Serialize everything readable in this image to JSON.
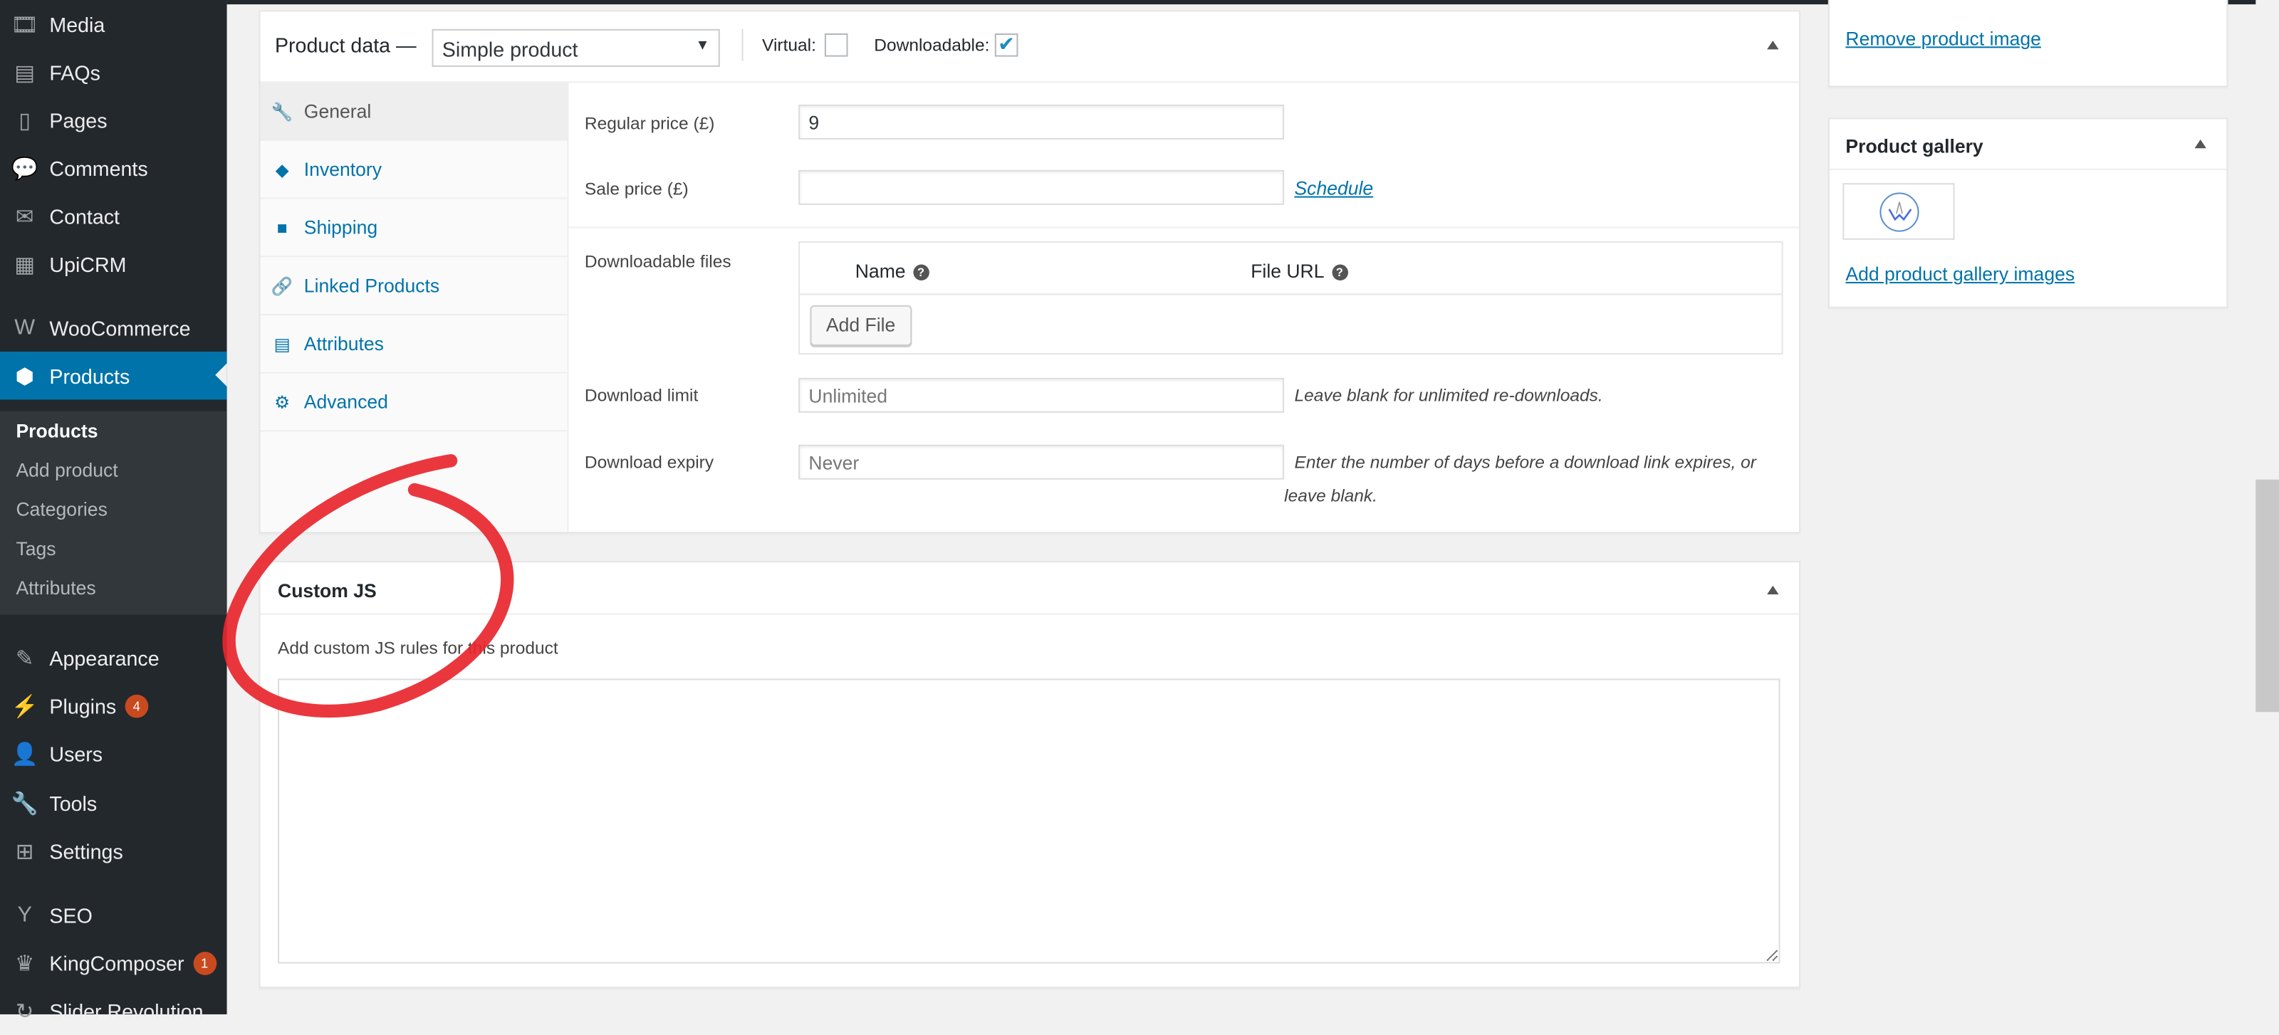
{
  "sidebar": {
    "items": [
      {
        "label": "Media",
        "icon": "media-icon"
      },
      {
        "label": "FAQs",
        "icon": "faq-icon"
      },
      {
        "label": "Pages",
        "icon": "pages-icon"
      },
      {
        "label": "Comments",
        "icon": "comments-icon"
      },
      {
        "label": "Contact",
        "icon": "mail-icon"
      },
      {
        "label": "UpiCRM",
        "icon": "upicrm-icon"
      },
      {
        "label": "WooCommerce",
        "icon": "woo-icon"
      },
      {
        "label": "Products",
        "icon": "box-icon"
      },
      {
        "label": "Appearance",
        "icon": "brush-icon"
      },
      {
        "label": "Plugins",
        "icon": "plugin-icon",
        "badge": "4"
      },
      {
        "label": "Users",
        "icon": "users-icon"
      },
      {
        "label": "Tools",
        "icon": "wrench-icon"
      },
      {
        "label": "Settings",
        "icon": "settings-icon"
      },
      {
        "label": "SEO",
        "icon": "yoast-icon"
      },
      {
        "label": "KingComposer",
        "icon": "crown-icon",
        "badge": "1"
      },
      {
        "label": "Slider Revolution",
        "icon": "refresh-icon"
      }
    ],
    "submenu": [
      "Products",
      "Add product",
      "Categories",
      "Tags",
      "Attributes"
    ]
  },
  "product_data": {
    "title": "Product data —",
    "type": "Simple product",
    "virtual_label": "Virtual:",
    "virtual": false,
    "downloadable_label": "Downloadable:",
    "downloadable": true,
    "tabs": [
      "General",
      "Inventory",
      "Shipping",
      "Linked Products",
      "Attributes",
      "Advanced"
    ],
    "regular_price_label": "Regular price (£)",
    "regular_price": "9",
    "sale_price_label": "Sale price (£)",
    "sale_price": "",
    "schedule": "Schedule",
    "downloadable_files_label": "Downloadable files",
    "col_name": "Name",
    "col_url": "File URL",
    "add_file": "Add File",
    "download_limit_label": "Download limit",
    "download_limit_placeholder": "Unlimited",
    "download_limit_hint": "Leave blank for unlimited re-downloads.",
    "download_expiry_label": "Download expiry",
    "download_expiry_placeholder": "Never",
    "download_expiry_hint1": "Enter the number of days before a download link expires, or",
    "download_expiry_hint2": "leave blank."
  },
  "custom_js": {
    "title": "Custom JS",
    "desc": "Add custom JS rules for this product",
    "value": ""
  },
  "product_image": {
    "remove": "Remove product image"
  },
  "gallery": {
    "title": "Product gallery",
    "add": "Add product gallery images"
  },
  "colors": {
    "accent": "#0073aa",
    "sidebar": "#23282d",
    "annotation": "#e8262e"
  }
}
